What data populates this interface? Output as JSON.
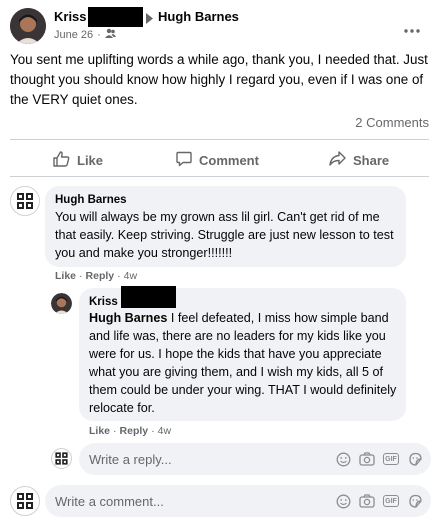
{
  "post": {
    "author_first": "Kriss",
    "recipient": "Hugh Barnes",
    "date": "June 26",
    "separator": "·",
    "body": "You sent me uplifting words a while ago, thank you, I needed that. Just thought you should know how highly I regard you, even if I was one of the VERY quiet ones.",
    "comments_count": "2 Comments"
  },
  "actions": {
    "like": "Like",
    "comment": "Comment",
    "share": "Share"
  },
  "comments": [
    {
      "author": "Hugh Barnes",
      "text": "You will always be my grown ass lil girl. Can't get rid of me that easily. Keep striving. Struggle are just new lesson to test you and make you stronger!!!!!!!",
      "like": "Like",
      "reply": "Reply",
      "dot": "·",
      "age": "4w"
    }
  ],
  "reply": {
    "author_first": "Kriss",
    "mention": "Hugh Barnes",
    "text": " I feel defeated, I miss how simple band and life was, there are no leaders for my kids like you were for us. I hope the kids that have you appreciate what you are giving them, and I wish my kids, all 5 of them could be under your wing. THAT I would definitely relocate for.",
    "like": "Like",
    "reply": "Reply",
    "dot": "·",
    "age": "4w"
  },
  "reply_input": {
    "placeholder": "Write a reply..."
  },
  "comment_input": {
    "placeholder": "Write a comment..."
  },
  "icons": {
    "gif_label": "GIF"
  },
  "colors": {
    "text_primary": "#050505",
    "text_muted": "#65676b",
    "bubble_bg": "#f0f2f5",
    "divider": "#ced0d4"
  }
}
